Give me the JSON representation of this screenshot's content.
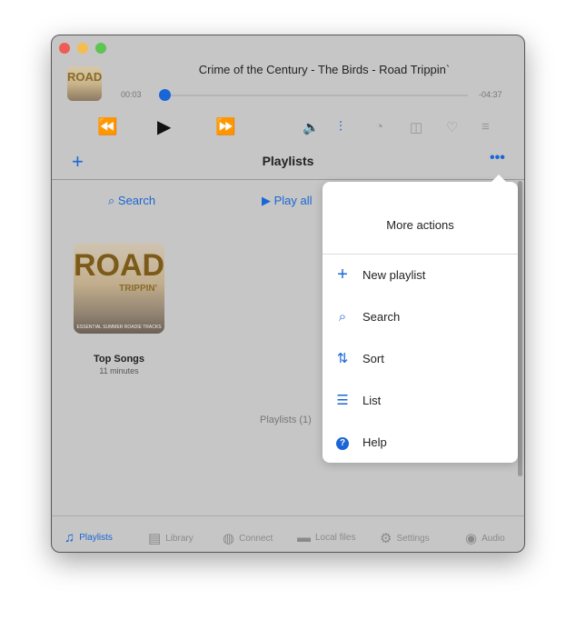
{
  "player": {
    "track_title": "Crime of the Century - The Birds - Road Trippin`",
    "elapsed": "00:03",
    "remaining": "-04:37",
    "progress": 0.01,
    "album_art_text": "ROAD",
    "album_art_subtext": "TRIPPIN"
  },
  "header": {
    "title": "Playlists"
  },
  "toolbar": {
    "search": "Search",
    "play_all": "Play all"
  },
  "playlists": [
    {
      "name": "Top Songs",
      "duration": "11 minutes",
      "art_text": "ROAD",
      "art_subtext": "TRIPPIN'",
      "art_footer": "ESSENTIAL SUMMER ROADIE TRACKS"
    }
  ],
  "footer_count": "Playlists (1)",
  "popover": {
    "title": "More actions",
    "items": [
      {
        "label": "New playlist",
        "icon": "plus-icon"
      },
      {
        "label": "Search",
        "icon": "search-icon"
      },
      {
        "label": "Sort",
        "icon": "sort-icon"
      },
      {
        "label": "List",
        "icon": "list-icon"
      },
      {
        "label": "Help",
        "icon": "help-icon"
      }
    ]
  },
  "tabs": [
    {
      "label": "Playlists",
      "active": true
    },
    {
      "label": "Library"
    },
    {
      "label": "Connect"
    },
    {
      "label": "Local files"
    },
    {
      "label": "Settings"
    },
    {
      "label": "Audio"
    }
  ],
  "colors": {
    "accent": "#1a66d6"
  }
}
